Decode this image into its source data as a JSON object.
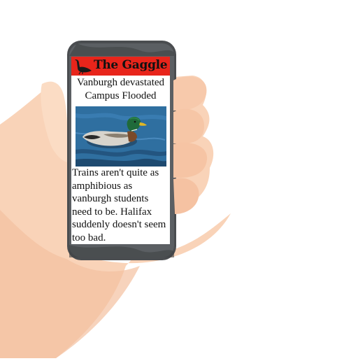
{
  "app": {
    "name": "The Gaggle",
    "logo_icon": "goose-silhouette-icon"
  },
  "article": {
    "headline_line1": "Vanburgh devastated",
    "headline_line2": "Campus Flooded",
    "image_icon": "mallard-duck-photo",
    "body": "Trains aren't quite as amphibious as vanburgh students need to be. Halifax suddenly doesn't seem too bad."
  },
  "colors": {
    "masthead": "#e8251b",
    "phone_body": "#4a4d50",
    "water": "#2f6fa0",
    "skin": "#f7cdb0"
  }
}
